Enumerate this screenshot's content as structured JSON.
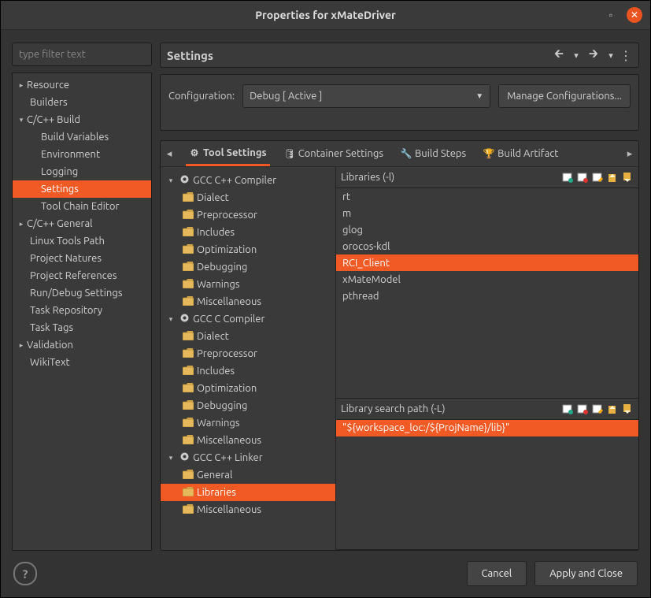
{
  "window": {
    "title": "Properties for xMateDriver"
  },
  "nav": {
    "filter_placeholder": "type filter text",
    "items": [
      {
        "label": "Resource",
        "expand": "▸",
        "cls": ""
      },
      {
        "label": "Builders",
        "expand": "",
        "cls": "ind1"
      },
      {
        "label": "C/C++ Build",
        "expand": "▾",
        "cls": ""
      },
      {
        "label": "Build Variables",
        "expand": "",
        "cls": "ind2"
      },
      {
        "label": "Environment",
        "expand": "",
        "cls": "ind2"
      },
      {
        "label": "Logging",
        "expand": "",
        "cls": "ind2"
      },
      {
        "label": "Settings",
        "expand": "",
        "cls": "ind2",
        "sel": true
      },
      {
        "label": "Tool Chain Editor",
        "expand": "",
        "cls": "ind2"
      },
      {
        "label": "C/C++ General",
        "expand": "▸",
        "cls": ""
      },
      {
        "label": "Linux Tools Path",
        "expand": "",
        "cls": "ind1"
      },
      {
        "label": "Project Natures",
        "expand": "",
        "cls": "ind1"
      },
      {
        "label": "Project References",
        "expand": "",
        "cls": "ind1"
      },
      {
        "label": "Run/Debug Settings",
        "expand": "",
        "cls": "ind1"
      },
      {
        "label": "Task Repository",
        "expand": "",
        "cls": "ind1"
      },
      {
        "label": "Task Tags",
        "expand": "",
        "cls": "ind1"
      },
      {
        "label": "Validation",
        "expand": "▸",
        "cls": ""
      },
      {
        "label": "WikiText",
        "expand": "",
        "cls": "ind1"
      }
    ]
  },
  "header": {
    "title": "Settings"
  },
  "config": {
    "label": "Configuration:",
    "value": "Debug  [ Active ]",
    "manage": "Manage Configurations..."
  },
  "tabs": [
    {
      "icon": "⚙",
      "label": "Tool Settings",
      "active": true
    },
    {
      "icon": "🛢",
      "label": "Container Settings"
    },
    {
      "icon": "🔧",
      "label": "Build Steps"
    },
    {
      "icon": "🏆",
      "label": "Build Artifact"
    }
  ],
  "tree": [
    {
      "label": "GCC C++ Compiler",
      "kind": "group",
      "expand": "▾"
    },
    {
      "label": "Dialect",
      "kind": "leaf"
    },
    {
      "label": "Preprocessor",
      "kind": "leaf"
    },
    {
      "label": "Includes",
      "kind": "leaf"
    },
    {
      "label": "Optimization",
      "kind": "leaf"
    },
    {
      "label": "Debugging",
      "kind": "leaf"
    },
    {
      "label": "Warnings",
      "kind": "leaf"
    },
    {
      "label": "Miscellaneous",
      "kind": "leaf"
    },
    {
      "label": "GCC C Compiler",
      "kind": "group",
      "expand": "▾"
    },
    {
      "label": "Dialect",
      "kind": "leaf"
    },
    {
      "label": "Preprocessor",
      "kind": "leaf"
    },
    {
      "label": "Includes",
      "kind": "leaf"
    },
    {
      "label": "Optimization",
      "kind": "leaf"
    },
    {
      "label": "Debugging",
      "kind": "leaf"
    },
    {
      "label": "Warnings",
      "kind": "leaf"
    },
    {
      "label": "Miscellaneous",
      "kind": "leaf"
    },
    {
      "label": "GCC C++ Linker",
      "kind": "group",
      "expand": "▾"
    },
    {
      "label": "General",
      "kind": "leaf"
    },
    {
      "label": "Libraries",
      "kind": "leaf",
      "sel": true
    },
    {
      "label": "Miscellaneous",
      "kind": "leaf"
    }
  ],
  "libraries": {
    "header": "Libraries (-l)",
    "items": [
      {
        "v": "rt"
      },
      {
        "v": "m"
      },
      {
        "v": "glog"
      },
      {
        "v": "orocos-kdl"
      },
      {
        "v": "RCI_Client",
        "sel": true
      },
      {
        "v": "xMateModel"
      },
      {
        "v": "pthread"
      }
    ]
  },
  "libpath": {
    "header": "Library search path (-L)",
    "items": [
      {
        "v": "\"${workspace_loc:/${ProjName}/lib}\"",
        "sel": true
      }
    ]
  },
  "footer": {
    "cancel": "Cancel",
    "apply": "Apply and Close"
  }
}
